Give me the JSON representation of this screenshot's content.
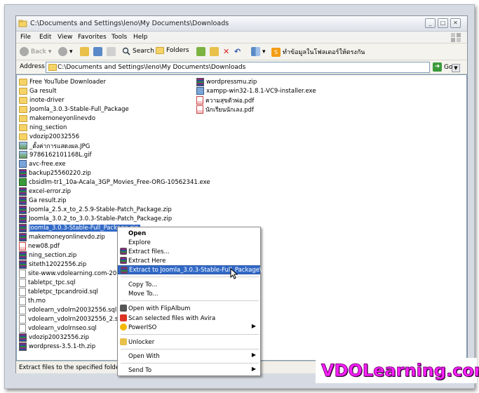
{
  "window": {
    "title": "C:\\Documents and Settings\\leno\\My Documents\\Downloads"
  },
  "menu": [
    "File",
    "Edit",
    "View",
    "Favorites",
    "Tools",
    "Help"
  ],
  "toolbar": {
    "back": "Back",
    "search": "Search",
    "folders": "Folders",
    "thai_action": "ทำข้อมูลในโฟลเดอร์ให้ตรงกัน"
  },
  "address": {
    "label": "Address",
    "path": "C:\\Documents and Settings\\leno\\My Documents\\Downloads",
    "go": "Go"
  },
  "files_col1": [
    {
      "name": "Free YouTube Downloader",
      "icon": "folder"
    },
    {
      "name": "Ga result",
      "icon": "folder"
    },
    {
      "name": "inote-driver",
      "icon": "folder"
    },
    {
      "name": "Joomla_3.0.3-Stable-Full_Package",
      "icon": "folder"
    },
    {
      "name": "makemoneyonlinevdo",
      "icon": "folder"
    },
    {
      "name": "ning_section",
      "icon": "folder"
    },
    {
      "name": "vdozip20032556",
      "icon": "folder"
    },
    {
      "name": "_ตั้งค่าการแสดงผล.JPG",
      "icon": "image"
    },
    {
      "name": "9786162101168L.gif",
      "icon": "image"
    },
    {
      "name": "avc-free.exe",
      "icon": "exe"
    },
    {
      "name": "backup25560220.zip",
      "icon": "zip"
    },
    {
      "name": "cbsidlm-tr1_10a-Acala_3GP_Movies_Free-ORG-10562341.exe",
      "icon": "green"
    },
    {
      "name": "excel-error.zip",
      "icon": "zip"
    },
    {
      "name": "Ga result.zip",
      "icon": "zip"
    },
    {
      "name": "Joomla_2.5.x_to_2.5.9-Stable-Patch_Package.zip",
      "icon": "zip"
    },
    {
      "name": "Joomla_3.0.2_to_3.0.3-Stable-Patch_Package.zip",
      "icon": "zip"
    },
    {
      "name": "Joomla_3.0.3-Stable-Full_Package.zip",
      "icon": "zip",
      "selected": true
    },
    {
      "name": "makemoneyonlinevdo.zip",
      "icon": "zip"
    },
    {
      "name": "new08.pdf",
      "icon": "pdf"
    },
    {
      "name": "ning_section.zip",
      "icon": "zip"
    },
    {
      "name": "siteth12022556.zip",
      "icon": "zip"
    },
    {
      "name": "site-www.vdolearning.com-201303",
      "icon": "doc"
    },
    {
      "name": "tabletpc_tpc.sql",
      "icon": "doc"
    },
    {
      "name": "tabletpc_tpcandroid.sql",
      "icon": "doc"
    },
    {
      "name": "th.mo",
      "icon": "doc"
    },
    {
      "name": "vdolearn_vdolrn20032556.sql",
      "icon": "doc"
    },
    {
      "name": "vdolearn_vdolrn20032556_2.sql",
      "icon": "doc"
    },
    {
      "name": "vdolearn_vdolrnseo.sql",
      "icon": "doc"
    },
    {
      "name": "vdozip20032556.zip",
      "icon": "zip"
    },
    {
      "name": "wordpress-3.5.1-th.zip",
      "icon": "zip"
    }
  ],
  "files_col2": [
    {
      "name": "wordpressmu.zip",
      "icon": "zip"
    },
    {
      "name": "xampp-win32-1.8.1-VC9-installer.exe",
      "icon": "exe"
    },
    {
      "name": "ความสุขตัวพ่อ.pdf",
      "icon": "pdf"
    },
    {
      "name": "นักเรียนนักเลง.pdf",
      "icon": "pdf"
    }
  ],
  "context_menu": {
    "open": "Open",
    "explore": "Explore",
    "extract_files": "Extract files...",
    "extract_here": "Extract Here",
    "extract_to": "Extract to Joomla_3.0.3-Stable-Full_Package\\",
    "copy_to": "Copy To...",
    "move_to": "Move To...",
    "open_flipalbum": "Open with FlipAlbum",
    "scan_avira": "Scan selected files with Avira",
    "poweriso": "PowerISO",
    "unlocker": "Unlocker",
    "open_with": "Open With",
    "send_to": "Send To"
  },
  "status": "Extract files to the specified folder",
  "watermark": "VDOLearning.com",
  "colors": {
    "selection": "#3169c6",
    "watermark": "#ff22ff"
  }
}
